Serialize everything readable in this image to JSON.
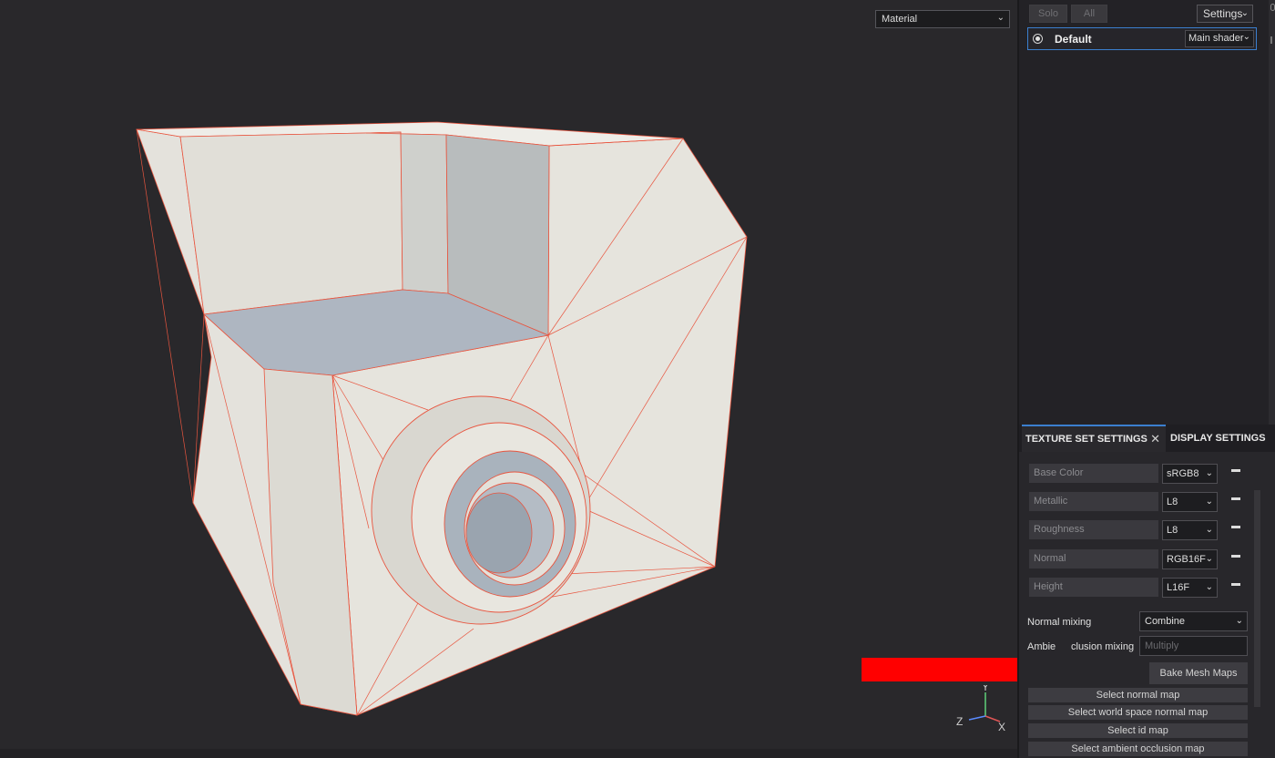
{
  "viewport": {
    "mode_select": "Material",
    "axis": {
      "x": "X",
      "y": "Y",
      "z": "Z"
    }
  },
  "layers": {
    "solo_label": "Solo",
    "all_label": "All",
    "settings_label": "Settings",
    "stack": {
      "name": "Default",
      "shader": "Main shader"
    }
  },
  "tabs": [
    {
      "label": "TEXTURE SET SETTINGS",
      "active": true
    },
    {
      "label": "DISPLAY SETTINGS",
      "active": false
    }
  ],
  "channels": [
    {
      "name": "Base Color",
      "format": "sRGB8"
    },
    {
      "name": "Metallic",
      "format": "L8"
    },
    {
      "name": "Roughness",
      "format": "L8"
    },
    {
      "name": "Normal",
      "format": "RGB16F"
    },
    {
      "name": "Height",
      "format": "L16F"
    }
  ],
  "normal_mixing": {
    "label": "Normal mixing",
    "value": "Combine"
  },
  "ao_mixing": {
    "label_left": "Ambie",
    "label_right": "clusion mixing",
    "value": "Multiply"
  },
  "bake_button": "Bake Mesh Maps",
  "map_buttons": [
    "Select normal map",
    "Select world space normal map",
    "Select id map",
    "Select ambient occlusion map"
  ],
  "colors": {
    "accent": "#3b7fcf",
    "arrow": "#ff0000",
    "wire": "#e8553f",
    "mesh_light": "#e3e1da",
    "mesh_shadow": "#a9b3bd"
  },
  "icons": {
    "dropdown": "chevron-down-icon",
    "radio": "radio-icon",
    "close": "close-icon",
    "remove": "minus-icon"
  }
}
